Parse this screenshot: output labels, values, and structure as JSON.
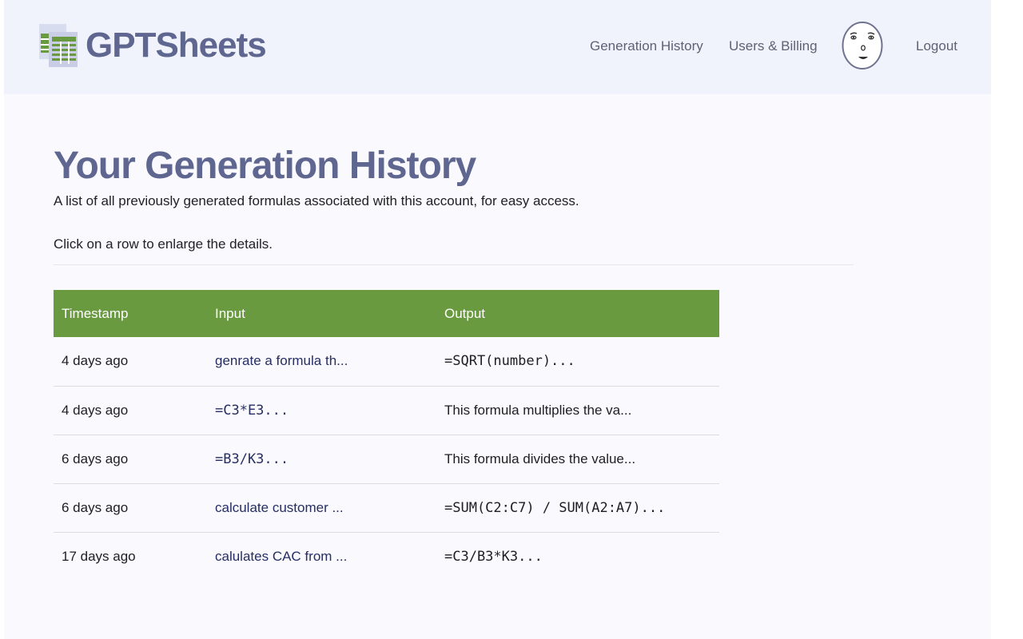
{
  "brand": {
    "name": "GPTSheets"
  },
  "nav": {
    "history_label": "Generation History",
    "billing_label": "Users & Billing",
    "logout_label": "Logout"
  },
  "page": {
    "title": "Your Generation History",
    "subtitle": "A list of all previously generated formulas associated with this account, for easy access.",
    "hint": "Click on a row to enlarge the details."
  },
  "table": {
    "headers": {
      "timestamp": "Timestamp",
      "input": "Input",
      "output": "Output"
    },
    "rows": [
      {
        "timestamp": "4 days ago",
        "input": "genrate a formula th...",
        "output": "=SQRT(number)..."
      },
      {
        "timestamp": "4 days ago",
        "input": "=C3*E3...",
        "output": "This formula multiplies the va..."
      },
      {
        "timestamp": "6 days ago",
        "input": "=B3/K3...",
        "output": "This formula divides the value..."
      },
      {
        "timestamp": "6 days ago",
        "input": "calculate  customer ...",
        "output": "=SUM(C2:C7) / SUM(A2:A7)..."
      },
      {
        "timestamp": "17 days ago",
        "input": "calulates  CAC from ...",
        "output": "=C3/B3*K3..."
      }
    ]
  },
  "icons": {
    "logo": "spreadsheet-icon",
    "avatar": "face-avatar-icon"
  },
  "colors": {
    "header_bg": "#f1f3fc",
    "page_bg": "#f9f9fe",
    "brand": "#5f6690",
    "table_header": "#6a9a3f",
    "input_text": "#262e63"
  }
}
